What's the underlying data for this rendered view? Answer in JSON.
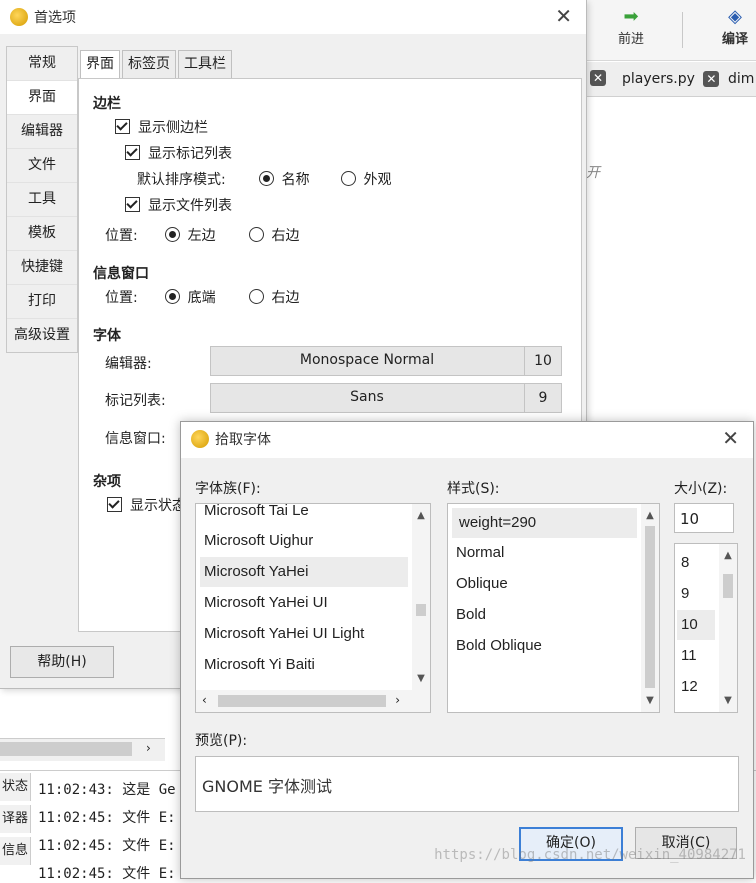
{
  "background": {
    "toolbar": {
      "forward_label": "前进",
      "compile_label": "编译"
    },
    "tabs": [
      "players.py",
      "dim"
    ],
    "editor_fragment": "开",
    "log": {
      "side_labels": [
        "状态",
        "译器",
        "信息"
      ],
      "lines": [
        "11:02:43: 这是 Ge",
        "11:02:45: 文件 E:",
        "11:02:45: 文件 E:",
        "11:02:45: 文件 E:"
      ]
    },
    "watermark": "https://blog.csdn.net/weixin_40984271"
  },
  "prefs": {
    "title": "首选项",
    "sidebar": [
      "常规",
      "界面",
      "编辑器",
      "文件",
      "工具",
      "模板",
      "快捷键",
      "打印",
      "高级设置"
    ],
    "tabs": [
      "界面",
      "标签页",
      "工具栏"
    ],
    "sidebar_section": {
      "title": "边栏",
      "show_sidebar": "显示侧边栏",
      "show_symbol_list": "显示标记列表",
      "sort_mode_label": "默认排序模式:",
      "sort_name": "名称",
      "sort_appearance": "外观",
      "show_file_list": "显示文件列表",
      "position_label": "位置:",
      "pos_left": "左边",
      "pos_right": "右边"
    },
    "msgwin_section": {
      "title": "信息窗口",
      "position_label": "位置:",
      "pos_bottom": "底端",
      "pos_right": "右边"
    },
    "font_section": {
      "title": "字体",
      "editor_label": "编辑器:",
      "editor_font": "Monospace Normal",
      "editor_size": "10",
      "symbol_label": "标记列表:",
      "symbol_font": "Sans",
      "symbol_size": "9",
      "msgwin_label": "信息窗口:"
    },
    "misc_section": {
      "title": "杂项",
      "show_status": "显示状态"
    },
    "help_button": "帮助(H)"
  },
  "font_dialog": {
    "title": "拾取字体",
    "family_label": "字体族(F):",
    "style_label": "样式(S):",
    "size_label": "大小(Z):",
    "families": [
      "Microsoft Tai Le",
      "Microsoft Uighur",
      "Microsoft YaHei",
      "Microsoft YaHei UI",
      "Microsoft YaHei UI Light",
      "Microsoft Yi Baiti"
    ],
    "styles": [
      "weight=290",
      "Normal",
      "Oblique",
      "Bold",
      "Bold Oblique"
    ],
    "size_value": "10",
    "sizes": [
      "8",
      "9",
      "10",
      "11",
      "12"
    ],
    "preview_label": "预览(P):",
    "preview_text": "GNOME 字体测试",
    "ok_button": "确定(O)",
    "cancel_button": "取消(C)"
  }
}
